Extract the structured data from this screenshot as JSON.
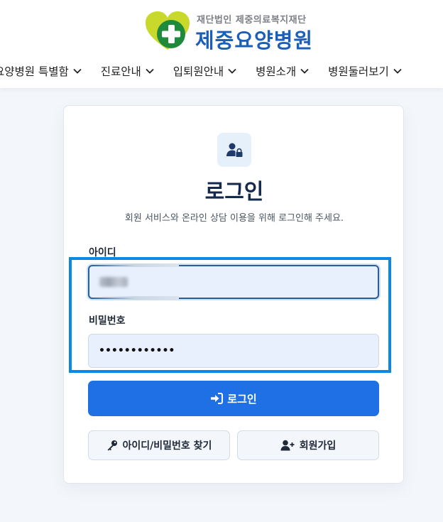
{
  "header": {
    "logo_sub": "재단법인 제중의료복지재단",
    "logo_main": "제중요양병원",
    "nav": [
      {
        "label": "요양병원 특별함"
      },
      {
        "label": "진료안내"
      },
      {
        "label": "입퇴원안내"
      },
      {
        "label": "병원소개"
      },
      {
        "label": "병원둘러보기"
      }
    ]
  },
  "login": {
    "title": "로그인",
    "subtitle": "회원 서비스와 온라인 상담 이용을 위해 로그인해 주세요.",
    "id_label": "아이디",
    "password_label": "비밀번호",
    "password_value": "••••••••••••",
    "submit_label": "로그인",
    "find_label": "아이디/비밀번호 찾기",
    "signup_label": "회원가입"
  },
  "colors": {
    "brand_blue": "#1d5fb8",
    "button_blue": "#1f6fe5",
    "logo_green": "#1f8a3b",
    "logo_yellow": "#c9d92b",
    "highlight": "#0b87e6"
  },
  "icons": [
    "chevron-down-icon",
    "user-lock-icon",
    "sign-in-icon",
    "key-icon",
    "user-plus-icon"
  ]
}
